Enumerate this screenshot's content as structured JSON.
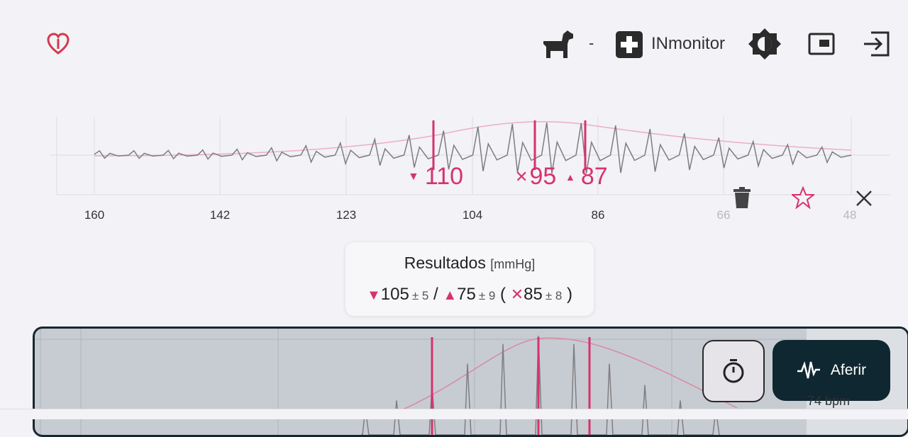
{
  "header": {
    "logo_icon": "heart-outline-logo-icon",
    "pet_icon": "dog-icon",
    "pet_separator": "-",
    "app_icon": "medical-cross-icon",
    "app_name": "INmonitor",
    "brightness_icon": "brightness-icon",
    "picture_in_picture_icon": "picture-in-picture-icon",
    "logout_icon": "logout-icon"
  },
  "pressure_chart": {
    "x_ticks": [
      "160",
      "142",
      "123",
      "104",
      "86",
      "66",
      "48"
    ],
    "faded_ticks": [
      "66",
      "48"
    ],
    "markers": {
      "systolic": "110",
      "mean": "95",
      "diastolic": "87"
    },
    "actions": {
      "delete_icon": "trash-icon",
      "favorite_icon": "star-icon",
      "close_icon": "close-icon"
    }
  },
  "results": {
    "title": "Resultados",
    "unit": "[mmHg]",
    "systolic_value": "105",
    "systolic_error": "± 5",
    "separator": "/",
    "diastolic_value": "75",
    "diastolic_error": "± 9",
    "open_paren": "(",
    "mean_value": "85",
    "mean_error": "± 8",
    "close_paren": ")"
  },
  "bottom_panel": {
    "timer_icon": "stopwatch-icon",
    "aferir_icon": "pulse-wave-icon",
    "aferir_label": "Aferir",
    "heart_rate_text": "74 bpm"
  },
  "colors": {
    "accent": "#d6336c",
    "dark": "#0f2730",
    "background": "#f3f2f6"
  }
}
